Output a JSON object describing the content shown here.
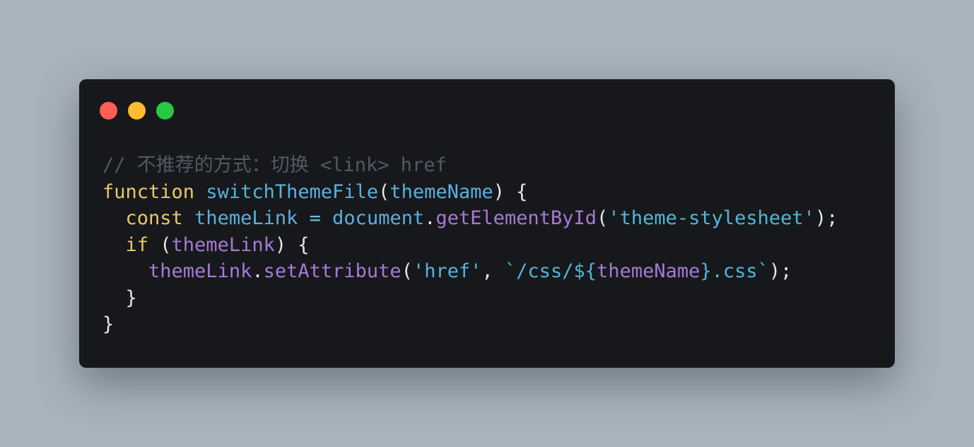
{
  "window": {
    "controls": {
      "close_color": "#ff5f57",
      "minimize_color": "#febc2e",
      "maximize_color": "#28c840"
    }
  },
  "code": {
    "language": "javascript",
    "lines": [
      [
        {
          "t": "// 不推荐的方式：切换 <link> href",
          "k": "comment"
        }
      ],
      [
        {
          "t": "function",
          "k": "keyword"
        },
        {
          "t": " ",
          "k": "punct"
        },
        {
          "t": "switchThemeFile",
          "k": "func"
        },
        {
          "t": "(",
          "k": "punct"
        },
        {
          "t": "themeName",
          "k": "param"
        },
        {
          "t": ") {",
          "k": "punct"
        }
      ],
      [
        {
          "t": "  ",
          "k": "punct"
        },
        {
          "t": "const",
          "k": "keyword"
        },
        {
          "t": " ",
          "k": "punct"
        },
        {
          "t": "themeLink",
          "k": "var"
        },
        {
          "t": " ",
          "k": "punct"
        },
        {
          "t": "=",
          "k": "op"
        },
        {
          "t": " ",
          "k": "punct"
        },
        {
          "t": "document",
          "k": "ident"
        },
        {
          "t": ".",
          "k": "punct"
        },
        {
          "t": "getElementById",
          "k": "method"
        },
        {
          "t": "(",
          "k": "punct"
        },
        {
          "t": "'theme-stylesheet'",
          "k": "string"
        },
        {
          "t": ");",
          "k": "punct"
        }
      ],
      [
        {
          "t": "  ",
          "k": "punct"
        },
        {
          "t": "if",
          "k": "keyword"
        },
        {
          "t": " (",
          "k": "punct"
        },
        {
          "t": "themeLink",
          "k": "prop"
        },
        {
          "t": ") {",
          "k": "punct"
        }
      ],
      [
        {
          "t": "    ",
          "k": "punct"
        },
        {
          "t": "themeLink",
          "k": "prop"
        },
        {
          "t": ".",
          "k": "punct"
        },
        {
          "t": "setAttribute",
          "k": "method"
        },
        {
          "t": "(",
          "k": "punct"
        },
        {
          "t": "'href'",
          "k": "string"
        },
        {
          "t": ", ",
          "k": "punct"
        },
        {
          "t": "`/css/${",
          "k": "string"
        },
        {
          "t": "themeName",
          "k": "prop"
        },
        {
          "t": "}.css`",
          "k": "string"
        },
        {
          "t": ");",
          "k": "punct"
        }
      ],
      [
        {
          "t": "  }",
          "k": "punct"
        }
      ],
      [
        {
          "t": "}",
          "k": "punct"
        }
      ]
    ]
  }
}
